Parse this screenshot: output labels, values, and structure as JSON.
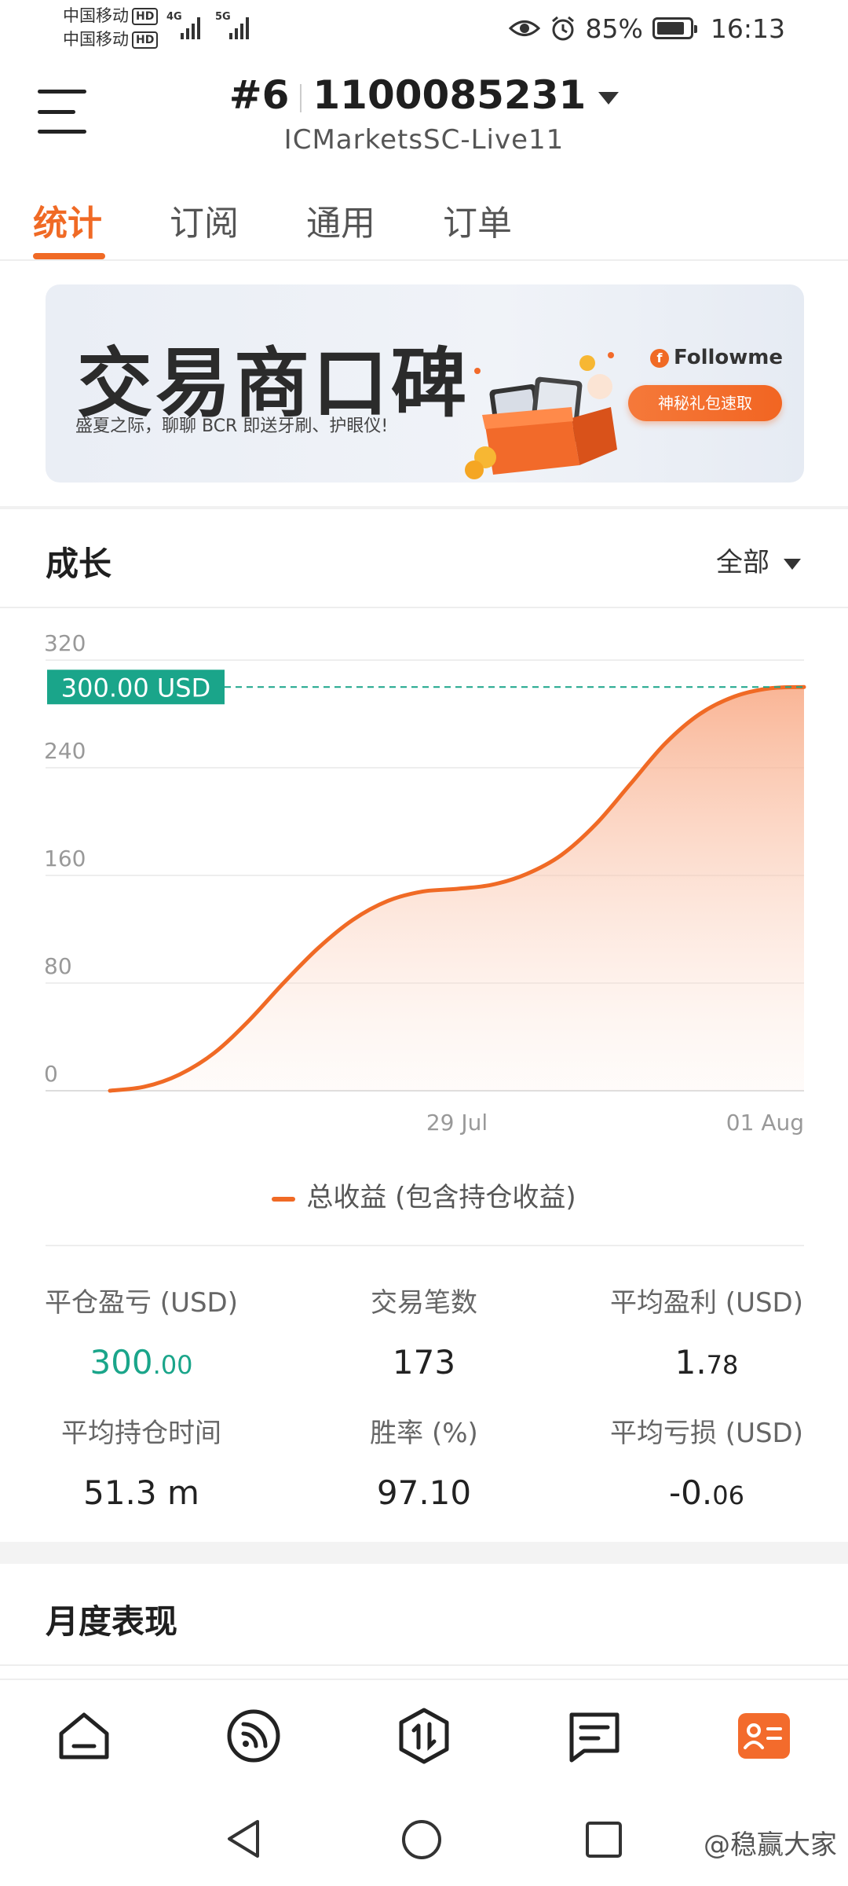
{
  "status_bar": {
    "carrier_1": "中国移动",
    "carrier_2": "中国移动",
    "hd": "HD",
    "net_1": "4G",
    "net_2": "5G",
    "battery": "85%",
    "time": "16:13"
  },
  "header": {
    "account_prefix": "#6",
    "account_number": "1100085231",
    "server": "ICMarketsSC-Live11"
  },
  "tabs": [
    {
      "label": "统计",
      "active": true
    },
    {
      "label": "订阅",
      "active": false
    },
    {
      "label": "通用",
      "active": false
    },
    {
      "label": "订单",
      "active": false
    }
  ],
  "banner": {
    "title": "交易商口碑",
    "subtitle": "盛夏之际，聊聊 BCR 即送牙刷、护眼仪!",
    "brand": "Followme",
    "button": "神秘礼包速取"
  },
  "growth": {
    "title": "成长",
    "range": "全部"
  },
  "chart_data": {
    "type": "area",
    "title": "",
    "xlabel": "",
    "ylabel": "",
    "ylim": [
      0,
      320
    ],
    "yticks": [
      "320",
      "240",
      "160",
      "80",
      "0"
    ],
    "xticks": [
      {
        "label": "29 Jul",
        "pos": 0.5
      },
      {
        "label": "01 Aug",
        "pos": 1.0
      }
    ],
    "current_label": "300.00 USD",
    "current_value": 300,
    "series": [
      {
        "name": "总收益 (包含持仓收益)",
        "color": "#f06a25",
        "x": [
          0,
          0.05,
          0.1,
          0.15,
          0.2,
          0.25,
          0.3,
          0.35,
          0.4,
          0.45,
          0.5,
          0.55,
          0.6,
          0.65,
          0.7,
          0.75,
          0.8,
          0.85,
          0.9,
          0.95,
          1.0
        ],
        "values": [
          0,
          3,
          12,
          28,
          52,
          80,
          106,
          127,
          141,
          148,
          150,
          153,
          161,
          175,
          198,
          228,
          258,
          280,
          293,
          299,
          300
        ]
      }
    ],
    "grid": true,
    "legend": "bottom"
  },
  "stats": [
    {
      "label": "平仓盈亏 (USD)",
      "int": "300",
      "dec": ".00",
      "color": "green"
    },
    {
      "label": "交易笔数",
      "int": "173",
      "dec": "",
      "color": "default"
    },
    {
      "label": "平均盈利 (USD)",
      "int": "1.",
      "dec": "78",
      "color": "default"
    },
    {
      "label": "平均持仓时间",
      "int": "51.3 m",
      "dec": "",
      "color": "default"
    },
    {
      "label": "胜率 (%)",
      "int": "97.10",
      "dec": "",
      "color": "default"
    },
    {
      "label": "平均亏损 (USD)",
      "int": "-0.",
      "dec": "06",
      "color": "default"
    }
  ],
  "monthly": {
    "title": "月度表现"
  },
  "bottom_nav": [
    {
      "name": "home-icon",
      "active": false
    },
    {
      "name": "feed-icon",
      "active": false
    },
    {
      "name": "trade-icon",
      "active": false
    },
    {
      "name": "message-icon",
      "active": false
    },
    {
      "name": "account-card-icon",
      "active": true
    }
  ],
  "watermark": "@稳赢大家",
  "accent": "#f06a25",
  "positive_color": "#1aa58a"
}
